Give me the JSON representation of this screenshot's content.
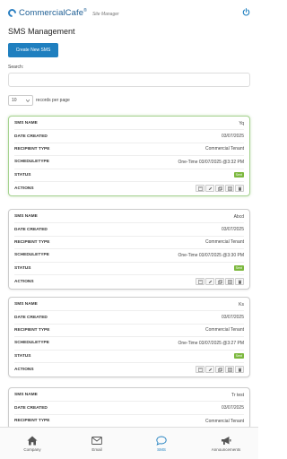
{
  "header": {
    "brand": "CommercialCafe",
    "brand_mark": "®",
    "subtitle": "Site Manager"
  },
  "page": {
    "title": "SMS Management",
    "create_button": "Create New SMS",
    "search_label": "Search:",
    "search_value": "",
    "records_per_page": "10",
    "records_per_page_label": "records per page"
  },
  "labels": {
    "sms_name": "SMS NAME",
    "date_created": "DATE CREATED",
    "recipient_type": "RECIPIENT TYPE",
    "schedule_type": "SCHEDULETYPE",
    "status": "STATUS",
    "actions": "ACTIONS"
  },
  "records": [
    {
      "sms_name": "Yq",
      "date_created": "03/07/2025",
      "recipient_type": "Commercial Tenant",
      "schedule_type": "One-Time 03/07/2025 @3:32 PM",
      "status": "Sent"
    },
    {
      "sms_name": "Abcd",
      "date_created": "03/07/2025",
      "recipient_type": "Commercial Tenant",
      "schedule_type": "One-Time 03/07/2025 @3:30 PM",
      "status": "Sent"
    },
    {
      "sms_name": "Ks",
      "date_created": "03/07/2025",
      "recipient_type": "Commercial Tenant",
      "schedule_type": "One-Time 03/07/2025 @3:27 PM",
      "status": "Sent"
    },
    {
      "sms_name": "Tr test",
      "date_created": "03/07/2025",
      "recipient_type": "Commercial Tenant",
      "schedule_type": "",
      "status": ""
    }
  ],
  "tabs": [
    {
      "label": "Company",
      "icon": "home-icon"
    },
    {
      "label": "Email",
      "icon": "envelope-icon"
    },
    {
      "label": "SMS",
      "icon": "chat-bubble-icon"
    },
    {
      "label": "Announcements",
      "icon": "megaphone-icon"
    }
  ],
  "colors": {
    "primary": "#1f7fbf",
    "status_sent": "#7cb83e",
    "active_card_border": "#a5d28f"
  }
}
